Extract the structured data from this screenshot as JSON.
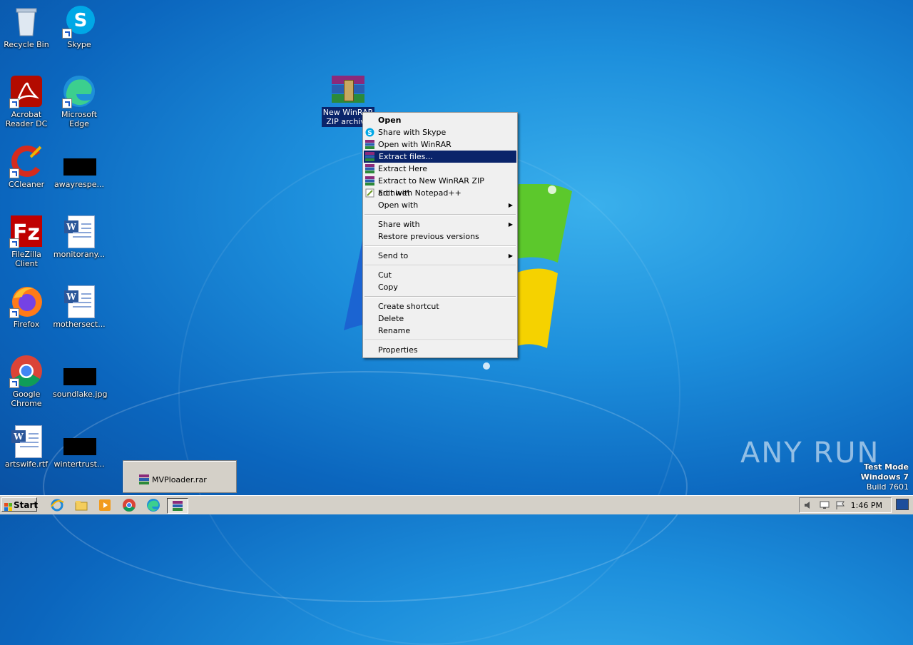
{
  "desktop": {
    "icons": [
      {
        "label": "Recycle Bin"
      },
      {
        "label": "Skype"
      },
      {
        "label": "Acrobat Reader DC"
      },
      {
        "label": "Microsoft Edge"
      },
      {
        "label": "CCleaner"
      },
      {
        "label": "awayrespe..."
      },
      {
        "label": "FileZilla Client"
      },
      {
        "label": "monitorany..."
      },
      {
        "label": "Firefox"
      },
      {
        "label": "mothersect..."
      },
      {
        "label": "Google Chrome"
      },
      {
        "label": "soundlake.jpg"
      },
      {
        "label": "artswife.rtf"
      },
      {
        "label": "wintertrust..."
      }
    ],
    "selected_file": {
      "label_line1": "New WinRAR",
      "label_line2": "ZIP archive"
    }
  },
  "context_menu": {
    "items": [
      {
        "label": "Open",
        "bold": true
      },
      {
        "label": "Share with Skype",
        "icon": "skype-icon"
      },
      {
        "label": "Open with WinRAR",
        "icon": "winrar-icon"
      },
      {
        "label": "Extract files...",
        "icon": "winrar-icon",
        "highlighted": true
      },
      {
        "label": "Extract Here",
        "icon": "winrar-icon"
      },
      {
        "label": "Extract to New WinRAR ZIP archive\\",
        "icon": "winrar-icon"
      },
      {
        "label": "Edit with Notepad++",
        "icon": "notepadpp-icon"
      },
      {
        "label": "Open with",
        "submenu": true
      },
      {
        "label": "Share with",
        "submenu": true
      },
      {
        "label": "Restore previous versions"
      },
      {
        "label": "Send to",
        "submenu": true
      },
      {
        "label": "Cut"
      },
      {
        "label": "Copy"
      },
      {
        "label": "Create shortcut"
      },
      {
        "label": "Delete"
      },
      {
        "label": "Rename"
      },
      {
        "label": "Properties"
      }
    ]
  },
  "drag_preview": {
    "label": "MVPloader.rar"
  },
  "watermark": {
    "brand": "ANY RUN",
    "test_mode": "Test Mode",
    "os": "Windows 7",
    "build": "Build 7601"
  },
  "taskbar": {
    "start_label": "Start",
    "clock": "1:46 PM"
  },
  "colors": {
    "highlight": "#0a246a",
    "menu_bg": "#f0f0f0",
    "taskbar_bg": "#d4d0c8"
  }
}
